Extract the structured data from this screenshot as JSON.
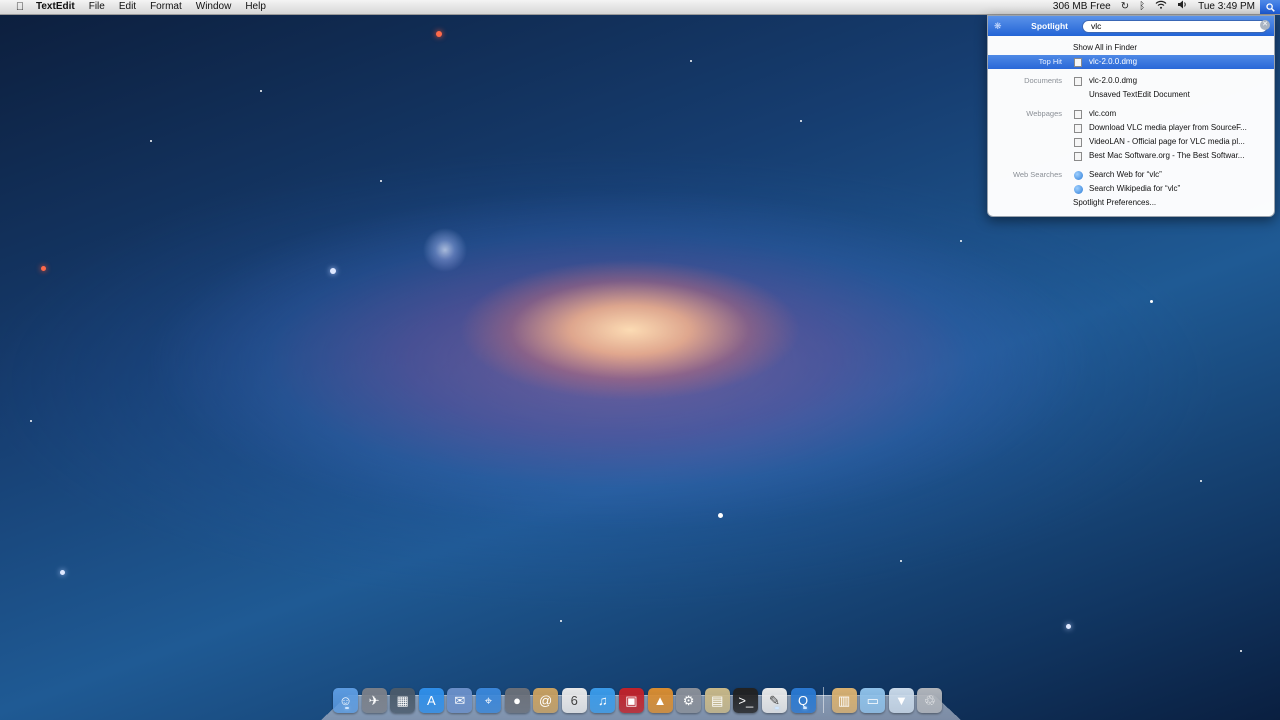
{
  "menubar": {
    "apple_icon": "apple-logo-icon",
    "app_name": "TextEdit",
    "menus": [
      "File",
      "Edit",
      "Format",
      "Window",
      "Help"
    ],
    "memory": "306 MB Free",
    "clock": "Tue 3:49 PM",
    "status_icons": [
      "time-machine-icon",
      "bluetooth-icon",
      "wifi-icon",
      "volume-icon"
    ]
  },
  "spotlight": {
    "title": "Spotlight",
    "query": "vlc",
    "show_all": "Show All in Finder",
    "top_hit": {
      "category": "Top Hit",
      "label": "vlc-2.0.0.dmg",
      "selected": true
    },
    "documents": {
      "category": "Documents",
      "items": [
        "vlc-2.0.0.dmg",
        "Unsaved TextEdit Document"
      ]
    },
    "webpages": {
      "category": "Webpages",
      "items": [
        "vlc.com",
        "Download VLC media player from SourceF...",
        "VideoLAN - Official page for VLC media pl...",
        "Best Mac Software.org - The Best Softwar..."
      ]
    },
    "web_searches": {
      "category": "Web Searches",
      "items": [
        "Search Web for “vlc”",
        "Search Wikipedia for “vlc”"
      ]
    },
    "preferences": "Spotlight Preferences...",
    "accent": "#2a68d8"
  },
  "dock": {
    "apps": [
      {
        "name": "finder-icon",
        "glyph": "☺",
        "color": "#5c9be0"
      },
      {
        "name": "launchpad-icon",
        "glyph": "✈",
        "color": "#7a7f88"
      },
      {
        "name": "mission-control-icon",
        "glyph": "▦",
        "color": "#4a5a6a"
      },
      {
        "name": "app-store-icon",
        "glyph": "A",
        "color": "#2f8ee8"
      },
      {
        "name": "mail-icon",
        "glyph": "✉",
        "color": "#6a8fc8"
      },
      {
        "name": "safari-icon",
        "glyph": "⌖",
        "color": "#3a86d8"
      },
      {
        "name": "facetime-icon",
        "glyph": "●",
        "color": "#6a6f78"
      },
      {
        "name": "address-book-icon",
        "glyph": "@",
        "color": "#c8a060"
      },
      {
        "name": "ical-icon",
        "glyph": "6",
        "color": "#e8e8e8"
      },
      {
        "name": "itunes-icon",
        "glyph": "♫",
        "color": "#3a9ae8"
      },
      {
        "name": "photo-booth-icon",
        "glyph": "▣",
        "color": "#c0222a"
      },
      {
        "name": "iphoto-icon",
        "glyph": "▲",
        "color": "#d88c30"
      },
      {
        "name": "system-preferences-icon",
        "glyph": "⚙",
        "color": "#8a8f98"
      },
      {
        "name": "preview-icon",
        "glyph": "▤",
        "color": "#c8b888"
      },
      {
        "name": "terminal-icon",
        "glyph": ">_",
        "color": "#222222"
      },
      {
        "name": "textedit-icon",
        "glyph": "✎",
        "color": "#e8e8e8"
      },
      {
        "name": "quicktime-icon",
        "glyph": "Q",
        "color": "#2a78d0"
      }
    ],
    "stacks": [
      {
        "name": "applications-stack-icon",
        "glyph": "▥",
        "color": "#d8b070"
      },
      {
        "name": "documents-folder-icon",
        "glyph": "▭",
        "color": "#8ec0e8"
      },
      {
        "name": "downloads-stack-icon",
        "glyph": "▼",
        "color": "#c8d8e8"
      },
      {
        "name": "trash-icon",
        "glyph": "♲",
        "color": "#b0b4ba"
      }
    ]
  }
}
